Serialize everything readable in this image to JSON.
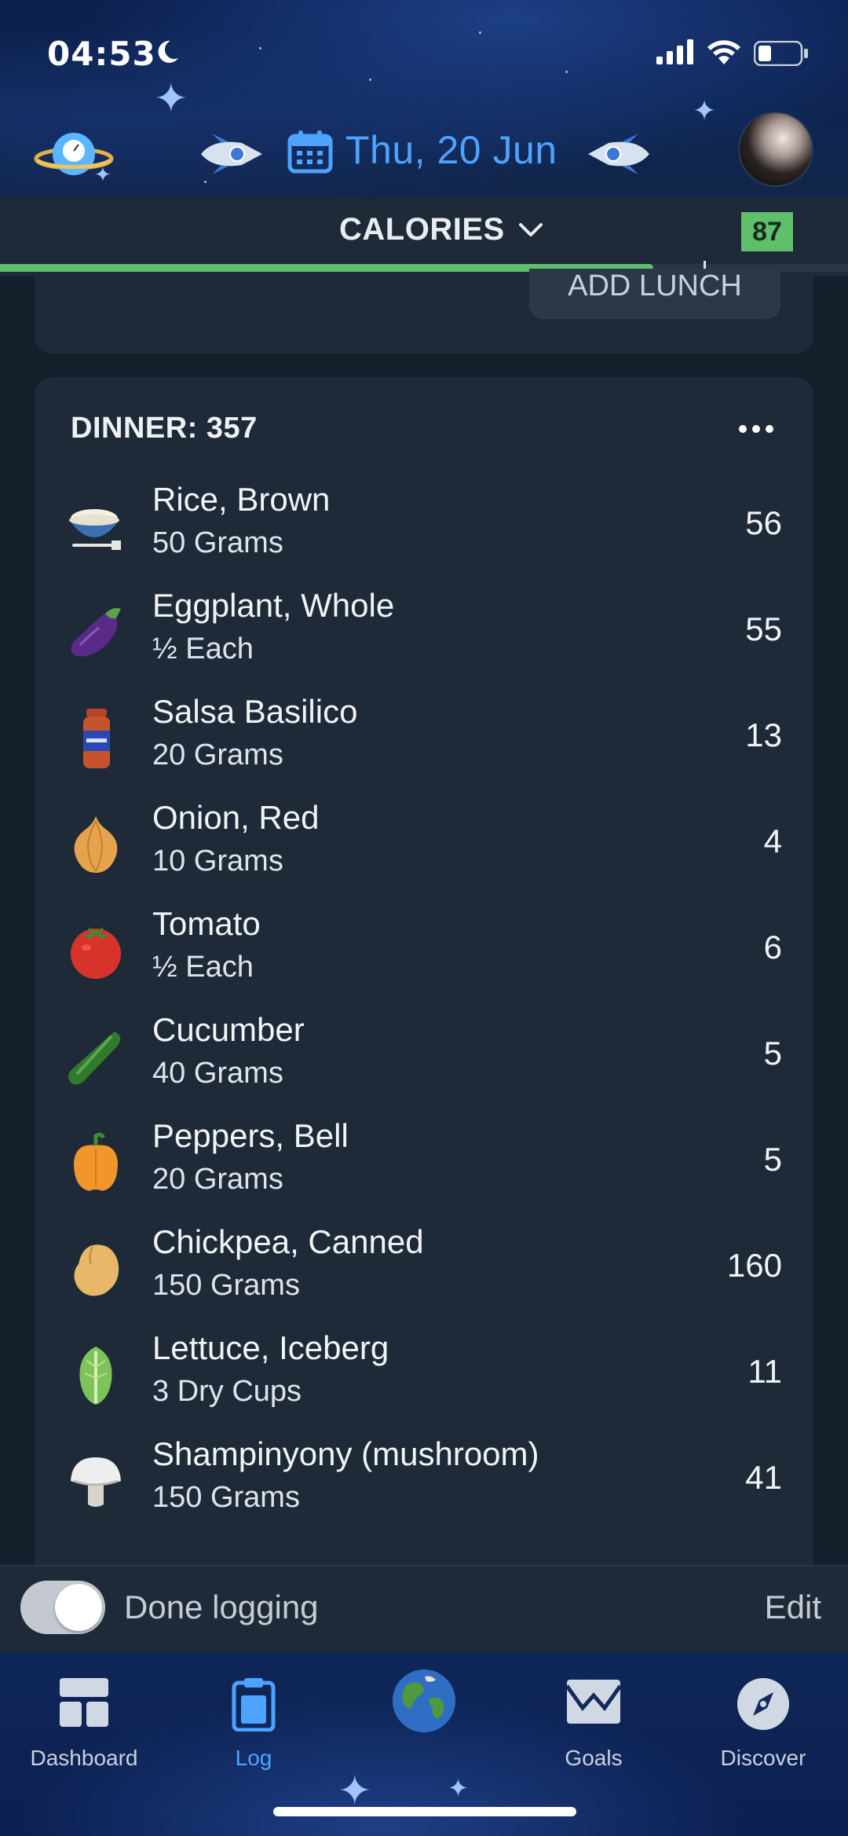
{
  "status_bar": {
    "time": "04:53"
  },
  "header": {
    "date": "Thu, 20 Jun"
  },
  "calories": {
    "title": "CALORIES",
    "badge": "87",
    "progress_fraction": 0.77
  },
  "lunch": {
    "add_button": "ADD LUNCH"
  },
  "dinner": {
    "title": "DINNER: 357",
    "items": [
      {
        "name": "Rice, Brown",
        "qty": "50 Grams",
        "cal": "56",
        "icon": "rice-bowl-icon"
      },
      {
        "name": "Eggplant, Whole",
        "qty": "½ Each",
        "cal": "55",
        "icon": "eggplant-icon"
      },
      {
        "name": "Salsa Basilico",
        "qty": "20 Grams",
        "cal": "13",
        "icon": "sauce-jar-icon"
      },
      {
        "name": "Onion, Red",
        "qty": "10 Grams",
        "cal": "4",
        "icon": "onion-icon"
      },
      {
        "name": "Tomato",
        "qty": "½ Each",
        "cal": "6",
        "icon": "tomato-icon"
      },
      {
        "name": "Cucumber",
        "qty": "40 Grams",
        "cal": "5",
        "icon": "cucumber-icon"
      },
      {
        "name": "Peppers, Bell",
        "qty": "20 Grams",
        "cal": "5",
        "icon": "bell-pepper-icon"
      },
      {
        "name": "Chickpea, Canned",
        "qty": "150 Grams",
        "cal": "160",
        "icon": "chickpea-icon"
      },
      {
        "name": "Lettuce, Iceberg",
        "qty": "3 Dry Cups",
        "cal": "11",
        "icon": "lettuce-icon"
      },
      {
        "name": "Shampinyony (mushroom)",
        "qty": "150 Grams",
        "cal": "41",
        "icon": "mushroom-icon"
      }
    ]
  },
  "done_bar": {
    "label": "Done logging",
    "edit": "Edit",
    "toggle_on": true
  },
  "tabs": [
    {
      "label": "Dashboard",
      "icon": "dashboard-icon",
      "active": false
    },
    {
      "label": "Log",
      "icon": "clipboard-icon",
      "active": true
    },
    {
      "label": "",
      "icon": "globe-icon",
      "active": false
    },
    {
      "label": "Goals",
      "icon": "goals-envelope-icon",
      "active": false
    },
    {
      "label": "Discover",
      "icon": "compass-icon",
      "active": false
    }
  ],
  "colors": {
    "accent_blue": "#4da3ff",
    "progress_green": "#5fbf6a",
    "card_bg": "#1e2a38"
  }
}
